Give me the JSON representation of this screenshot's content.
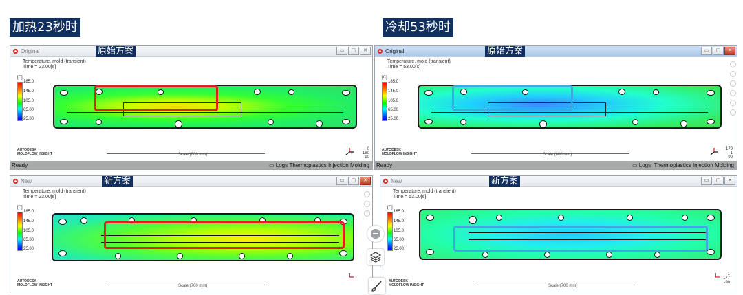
{
  "headers": {
    "left": "加热23秒时",
    "right": "冷却53秒时"
  },
  "colors": {
    "header_bg": "#12305f",
    "highlight_red": "#e0201c",
    "highlight_blue": "#3ea8e0"
  },
  "panels": {
    "heat_original": {
      "window_title": "Original",
      "tag": "原始方案",
      "plot_title": "Temperature, mold (transient)",
      "plot_time": "Time = 23.00[s]",
      "legend_unit": "[C]",
      "legend_ticks": [
        "185.0",
        "145.0",
        "105.0",
        "65.00",
        "25.00"
      ],
      "vendor_line1": "AUTODESK",
      "vendor_line2": "MOLDFLOW INSIGHT",
      "scale_label": "Scale (800 mm)",
      "axis_numbers": [
        "0",
        "180",
        "90"
      ],
      "status_left": "Ready",
      "status_logs": "Logs",
      "status_mode": "Thermoplastics Injection Molding"
    },
    "cool_original": {
      "window_title": "Original",
      "tag": "原始方案",
      "plot_title": "Temperature, mold (transient)",
      "plot_time": "Time = 53.00[s]",
      "legend_unit": "[C]",
      "legend_ticks": [
        "185.0",
        "145.0",
        "105.0",
        "65.00",
        "25.00"
      ],
      "vendor_line1": "AUTODESK",
      "vendor_line2": "MOLDFLOW INSIGHT",
      "scale_label": "Scale (800 mm)",
      "axis_numbers": [
        "179",
        "-1",
        "-90"
      ],
      "status_left": "Ready",
      "status_logs": "Logs",
      "status_mode": "Thermoplastics Injection Molding"
    },
    "heat_new": {
      "window_title": "New",
      "tag": "新方案",
      "plot_title": "Temperature, mold (transient)",
      "plot_time": "Time = 23.00[s]",
      "legend_unit": "[C]",
      "legend_ticks": [
        "185.0",
        "145.0",
        "105.0",
        "65.00",
        "25.00"
      ],
      "vendor_line1": "AUTODESK",
      "vendor_line2": "MOLDFLOW INSIGHT",
      "scale_label": "Scale (700 mm)"
    },
    "cool_new": {
      "window_title": "New",
      "tag": "新方案",
      "plot_title": "Temperature, mold (transient)",
      "plot_time": "Time = 53.00[s]",
      "legend_unit": "[C]",
      "legend_ticks": [
        "185.0",
        "145.0",
        "105.0",
        "65.00",
        "25.00"
      ],
      "vendor_line1": "AUTODESK",
      "vendor_line2": "MOLDFLOW INSIGHT",
      "scale_label": "Scale (700 mm)",
      "axis_numbers": [
        "-1",
        "177",
        "-90"
      ]
    }
  },
  "floating_tools": [
    "minus-icon",
    "layers-icon",
    "brush-icon"
  ]
}
